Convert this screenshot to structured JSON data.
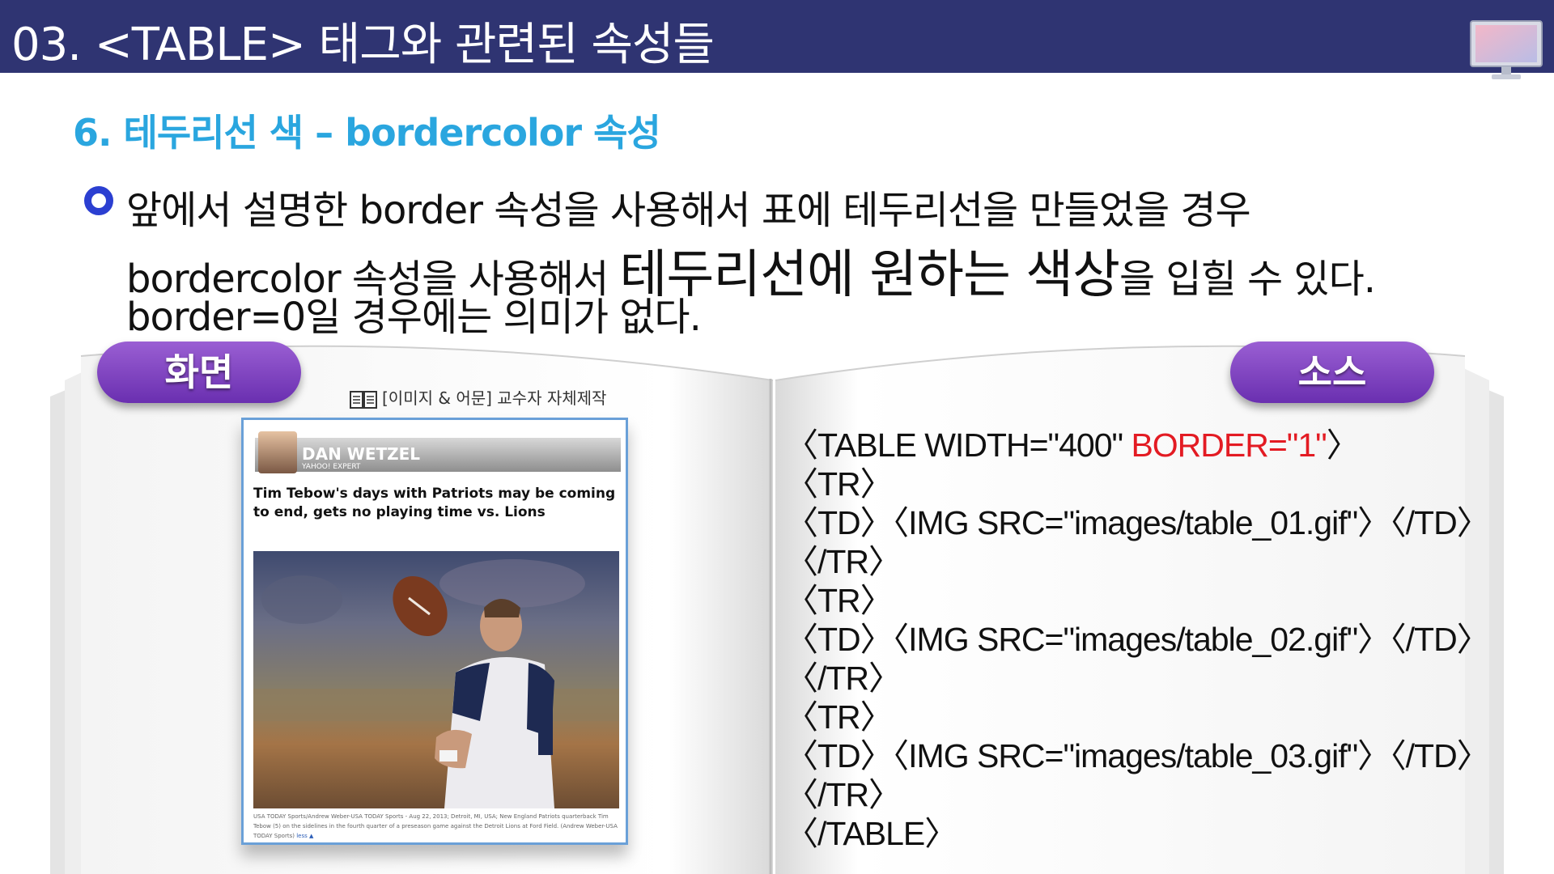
{
  "header": {
    "title": "03. <TABLE> 태그와 관련된 속성들",
    "icon": "monitor-icon"
  },
  "subtitle": "6. 테두리선 색 – bordercolor 속성",
  "body": {
    "bullet_icon": "ring-bullet-icon",
    "line1": "앞에서 설명한 border 속성을 사용해서 표에 테두리선을 만들었을 경우",
    "line2_a": "bordercolor 속성을 사용해서 ",
    "line2_big": "테두리선에 원하는 색상",
    "line2_b": "을 입힐 수 있다.",
    "line3": "border=0일 경우에는 의미가 없다."
  },
  "tabs": {
    "screen": "화면",
    "source": "소스"
  },
  "attribution": "[이미지 & 어문] 교수자 자체제작",
  "preview": {
    "byline_name": "DAN WETZEL",
    "byline_sub": "YAHOO! EXPERT",
    "headline": "Tim Tebow's days with Patriots may be coming to end, gets no playing time vs. Lions",
    "caption": "USA TODAY Sports/Andrew Weber-USA TODAY Sports - Aug 22, 2013; Detroit, MI, USA; New England Patriots quarterback Tim Tebow (5) on the sidelines in the fourth quarter of a preseason game against the Detroit Lions at Ford Field. (Andrew Weber-USA TODAY Sports)",
    "caption_link": "less ▲"
  },
  "code": {
    "line1_a": "〈TABLE WIDTH=\"400\" ",
    "line1_hl": "BORDER=\"1\"",
    "line1_b": "〉",
    "line2": "〈TR〉",
    "line3": "〈TD〉〈IMG SRC=\"images/table_01.gif\"〉〈/TD〉",
    "line4": "〈/TR〉",
    "line5": "〈TR〉",
    "line6": "〈TD〉〈IMG SRC=\"images/table_02.gif\"〉〈/TD〉",
    "line7": "〈/TR〉",
    "line8": "〈TR〉",
    "line9": "〈TD〉〈IMG SRC=\"images/table_03.gif\"〉〈/TD〉",
    "line10": "〈/TR〉",
    "line11": "〈/TABLE〉",
    "highlight_color": "#e31b23"
  },
  "colors": {
    "header_bg": "#2f3472",
    "subtitle": "#2aa6df",
    "bullet": "#2b3fd1",
    "tab": "#7b3fbf"
  }
}
